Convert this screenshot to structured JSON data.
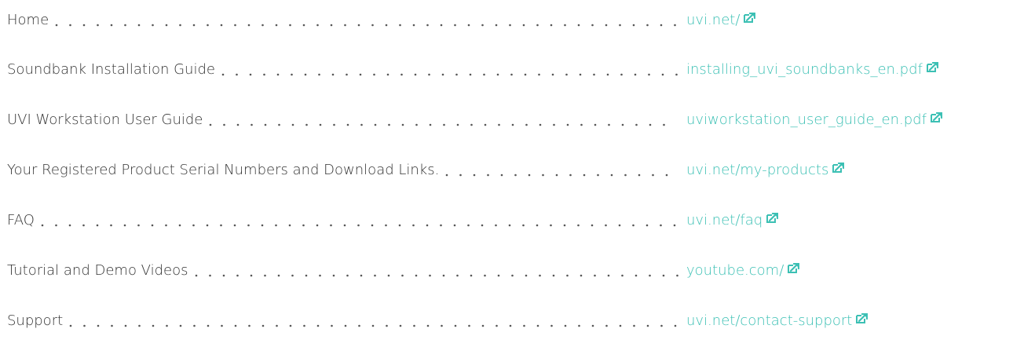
{
  "accent_color": "#3cc0b4",
  "links": [
    {
      "label": "Home",
      "url_text": "uvi.net/",
      "icon": "external-link-icon"
    },
    {
      "label": "Soundbank Installation Guide",
      "url_text": "installing_uvi_soundbanks_en.pdf",
      "icon": "external-link-icon"
    },
    {
      "label": "UVI Workstation User Guide",
      "url_text": "uviworkstation_user_guide_en.pdf",
      "icon": "external-link-icon"
    },
    {
      "label": "Your Registered Product Serial Numbers and Download Links.",
      "url_text": "uvi.net/my-products",
      "icon": "external-link-icon"
    },
    {
      "label": "FAQ",
      "url_text": "uvi.net/faq",
      "icon": "external-link-icon"
    },
    {
      "label": "Tutorial and Demo Videos",
      "url_text": "youtube.com/",
      "icon": "external-link-icon"
    },
    {
      "label": "Support",
      "url_text": "uvi.net/contact-support",
      "icon": "external-link-icon"
    }
  ]
}
